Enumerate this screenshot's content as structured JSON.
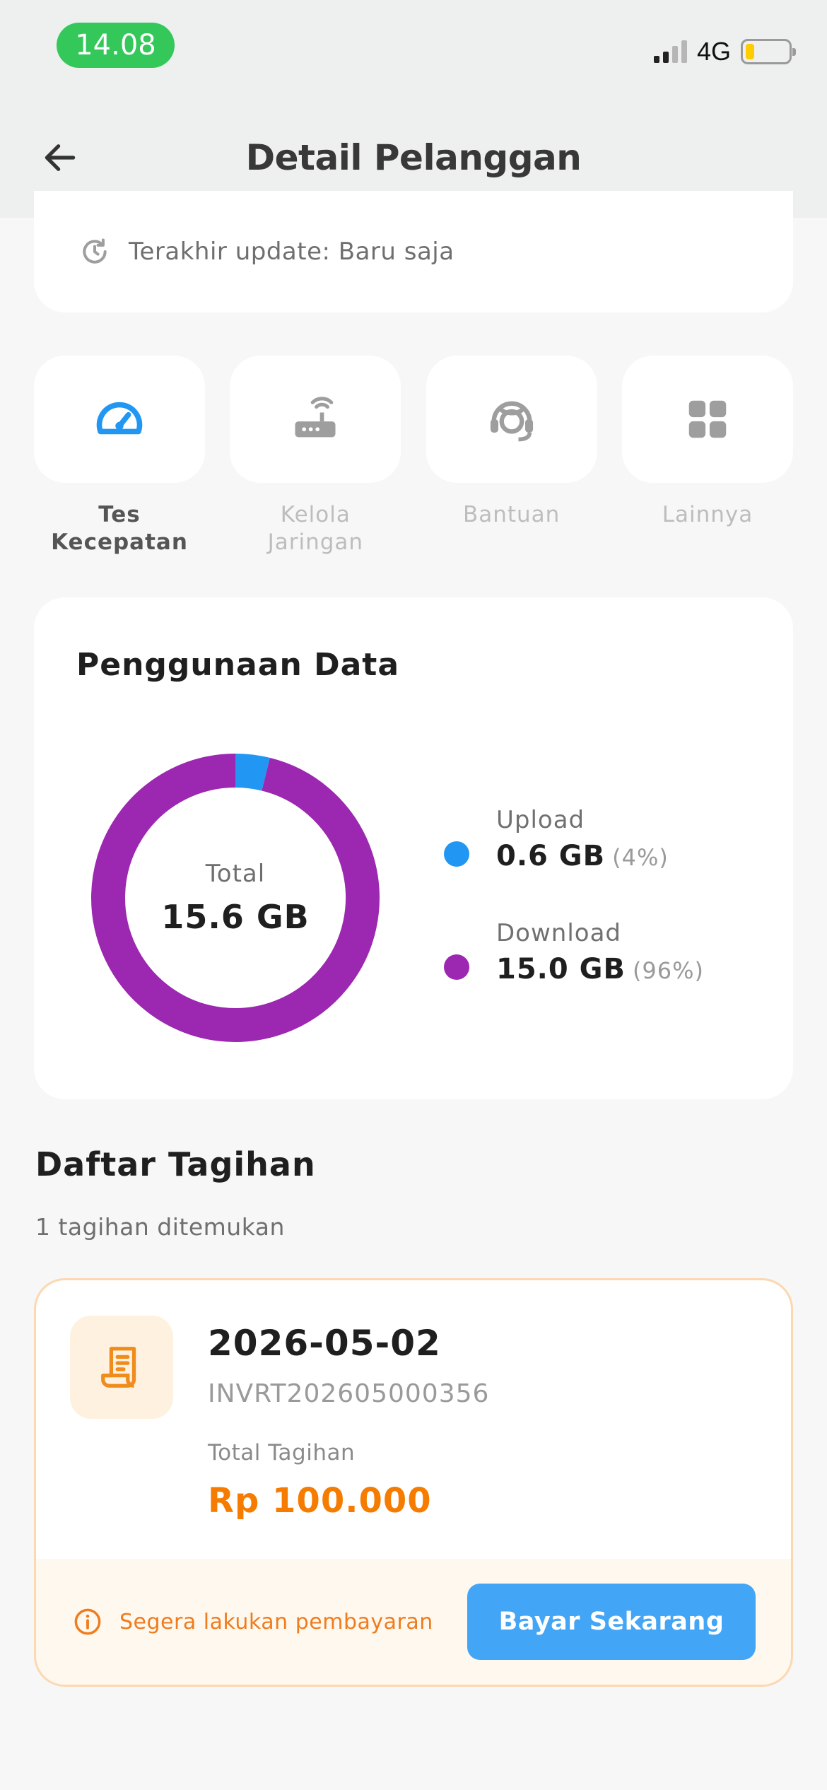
{
  "status_bar": {
    "time": "14.08",
    "network": "4G"
  },
  "header": {
    "title": "Detail Pelanggan",
    "back_icon": "arrow-left-icon"
  },
  "update": {
    "text": "Terakhir update: Baru saja",
    "icon": "refresh-icon"
  },
  "quick_actions": [
    {
      "label": "Tes\nKecepatan",
      "icon": "speedometer-icon",
      "active": true,
      "color": "#2196f3"
    },
    {
      "label": "Kelola\nJaringan",
      "icon": "router-icon",
      "active": false,
      "color": "#9e9e9e"
    },
    {
      "label": "Bantuan",
      "icon": "headset-icon",
      "active": false,
      "color": "#9e9e9e"
    },
    {
      "label": "Lainnya",
      "icon": "grid-icon",
      "active": false,
      "color": "#9e9e9e"
    }
  ],
  "usage": {
    "title": "Penggunaan Data",
    "total_label": "Total",
    "total_value": "15.6 GB",
    "items": [
      {
        "name": "Upload",
        "value": "0.6 GB",
        "percent": "(4%)",
        "color": "#2196f3"
      },
      {
        "name": "Download",
        "value": "15.0 GB",
        "percent": "(96%)",
        "color": "#9c27b0"
      }
    ]
  },
  "chart_data": {
    "type": "pie",
    "categories": [
      "Upload",
      "Download"
    ],
    "values": [
      0.6,
      15.0
    ],
    "unit": "GB"
  },
  "bills": {
    "title": "Daftar Tagihan",
    "count_text": "1 tagihan ditemukan",
    "items": [
      {
        "date": "2026-05-02",
        "invoice": "INVRT202605000356",
        "total_label": "Total Tagihan",
        "amount": "Rp 100.000",
        "warning": "Segera lakukan pembayaran",
        "pay_label": "Bayar Sekarang"
      }
    ]
  },
  "colors": {
    "accent": "#42a5f5",
    "warning": "#f57c00",
    "purple": "#9c27b0",
    "blue": "#2196f3"
  }
}
